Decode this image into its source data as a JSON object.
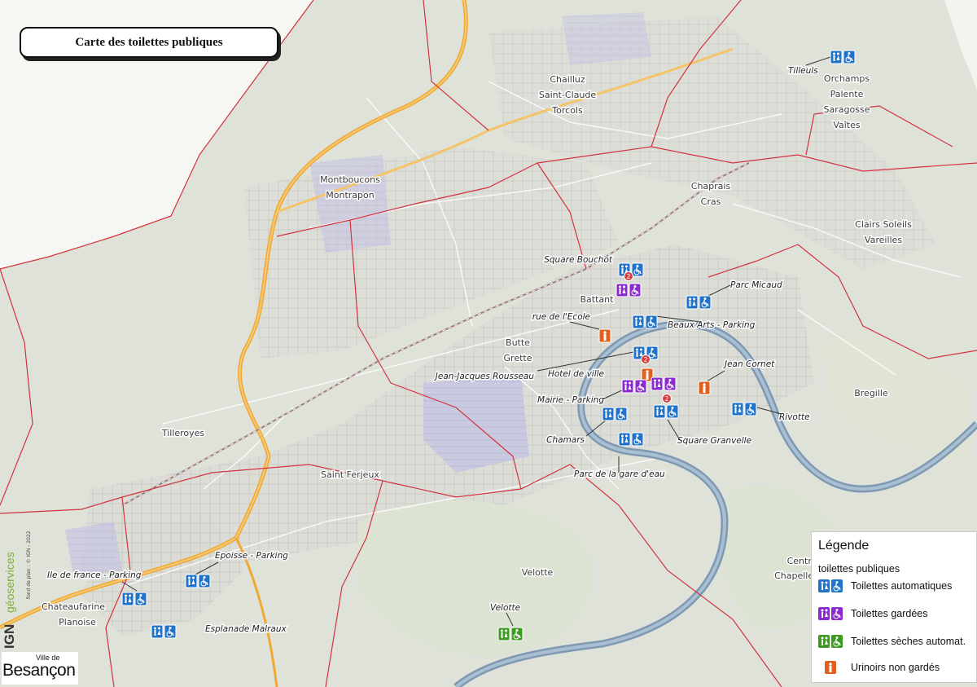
{
  "title": "Carte des toilettes publiques",
  "districts": [
    {
      "label": "Chailluz"
    },
    {
      "label": "Saint-Claude"
    },
    {
      "label": "Torcols"
    },
    {
      "label": "Orchamps"
    },
    {
      "label": "Palente"
    },
    {
      "label": "Saragosse"
    },
    {
      "label": "Vaîtes"
    },
    {
      "label": "Montboucons"
    },
    {
      "label": "Montrapon"
    },
    {
      "label": "Chaprais"
    },
    {
      "label": "Cras"
    },
    {
      "label": "Clairs Soleils"
    },
    {
      "label": "Vareilles"
    },
    {
      "label": "Battant"
    },
    {
      "label": "Butte"
    },
    {
      "label": "Grette"
    },
    {
      "label": "Bregille"
    },
    {
      "label": "Tilleroyes"
    },
    {
      "label": "Saint Ferjeux"
    },
    {
      "label": "Velotte"
    },
    {
      "label": "Chateaufarine"
    },
    {
      "label": "Planoise"
    },
    {
      "label": "Chapelle des Buis"
    },
    {
      "label": "Centre"
    }
  ],
  "places": [
    {
      "label": "Tilleuls",
      "kind": "automatic"
    },
    {
      "label": "Square Bouchot",
      "kind": "automatic"
    },
    {
      "label": "Parc Micaud",
      "kind": "automatic"
    },
    {
      "label": "rue de l'Ecole",
      "kind": "urinal"
    },
    {
      "label": "Beaux Arts - Parking",
      "kind": "automatic"
    },
    {
      "label": "Jean Cornet",
      "kind": "urinal"
    },
    {
      "label": "Jean-Jacques Rousseau",
      "kind": "automatic"
    },
    {
      "label": "Hotel de ville",
      "kind": "urinal"
    },
    {
      "label": "Mairie - Parking",
      "kind": "guarded"
    },
    {
      "label": "Rivotte",
      "kind": "automatic"
    },
    {
      "label": "Chamars",
      "kind": "automatic"
    },
    {
      "label": "Square Granvelle",
      "kind": "automatic"
    },
    {
      "label": "Parc de la gare d'eau",
      "kind": "automatic"
    },
    {
      "label": "Epoisse - Parking",
      "kind": "automatic"
    },
    {
      "label": "Ile de france - Parking",
      "kind": "automatic"
    },
    {
      "label": "Esplanade Malraux",
      "kind": "automatic"
    },
    {
      "label": "Velotte",
      "kind": "dry"
    }
  ],
  "count_badges": [
    "2",
    "2",
    "2"
  ],
  "legend": {
    "heading": "Légende",
    "subtitle": "toilettes publiques",
    "items": [
      {
        "label": "Toilettes automatiques",
        "kind": "automatic"
      },
      {
        "label": "Toilettes gardées",
        "kind": "guarded"
      },
      {
        "label": "Toilettes sèches automat.",
        "kind": "dry"
      },
      {
        "label": "Urinoirs non gardés",
        "kind": "urinal"
      }
    ]
  },
  "colors": {
    "automatic": "#2173c9",
    "guarded": "#8a2bd0",
    "dry": "#3e9b22",
    "urinal": "#e2601d",
    "river": "#7f99b3",
    "boundary": "#d2333f",
    "highway": "#f0a830",
    "railway": "#9c7e7e"
  },
  "icons": {
    "toilet": "toilet-man-woman-icon",
    "accessible": "wheelchair-icon",
    "urinal": "man-icon"
  },
  "credits": {
    "ign": "IGN",
    "geoservices": "géoservices",
    "plan": "fond de plan : © IGN - 2022"
  },
  "logo": {
    "small": "Ville de",
    "big": "Besançon"
  }
}
